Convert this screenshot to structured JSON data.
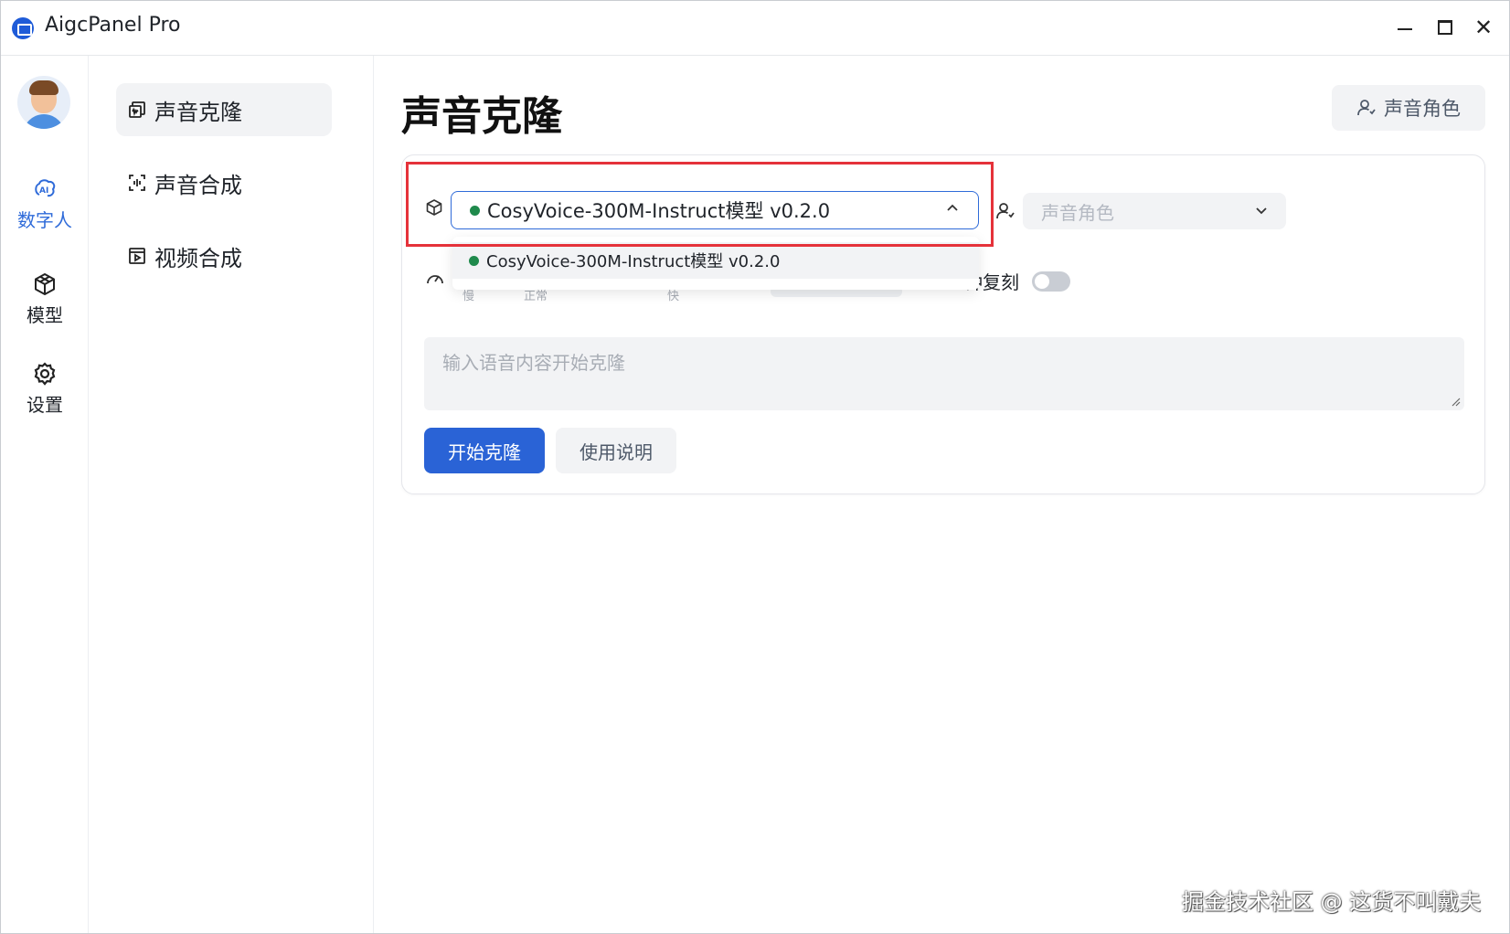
{
  "app": {
    "title": "AigcPanel Pro",
    "logo_icon": "app-logo-icon"
  },
  "window_controls": {
    "minimize_icon": "minimize-icon",
    "maximize_icon": "maximize-icon",
    "close_glyph": "✕"
  },
  "rail": {
    "items": [
      {
        "label": "数字人",
        "icon": "ai-icon",
        "active": true
      },
      {
        "label": "模型",
        "icon": "cube-icon",
        "active": false
      },
      {
        "label": "设置",
        "icon": "gear-icon",
        "active": false
      }
    ]
  },
  "sidebar": {
    "items": [
      {
        "label": "声音克隆",
        "icon": "voice-clone-icon",
        "active": true
      },
      {
        "label": "声音合成",
        "icon": "voice-synthesis-icon",
        "active": false
      },
      {
        "label": "视频合成",
        "icon": "video-synthesis-icon",
        "active": false
      }
    ]
  },
  "main": {
    "title": "声音克隆",
    "role_button_label": "声音角色",
    "model_select": {
      "value": "CosyVoice-300M-Instruct模型 v0.2.0",
      "status_color": "#1f8a4c",
      "expanded": true,
      "options": [
        "CosyVoice-300M-Instruct模型 v0.2.0"
      ]
    },
    "role_select": {
      "placeholder": "声音角色"
    },
    "speed": {
      "ticks": [
        "慢",
        "正常",
        "快"
      ]
    },
    "toggle": {
      "label_partial": "钟复刻",
      "on": false
    },
    "textarea": {
      "placeholder": "输入语音内容开始克隆"
    },
    "buttons": {
      "start": "开始克隆",
      "help": "使用说明"
    }
  },
  "watermark": "掘金技术社区 @ 这货不叫戴夫",
  "colors": {
    "accent": "#2a63d6",
    "highlight": "#e5323a",
    "status_ok": "#1f8a4c"
  }
}
